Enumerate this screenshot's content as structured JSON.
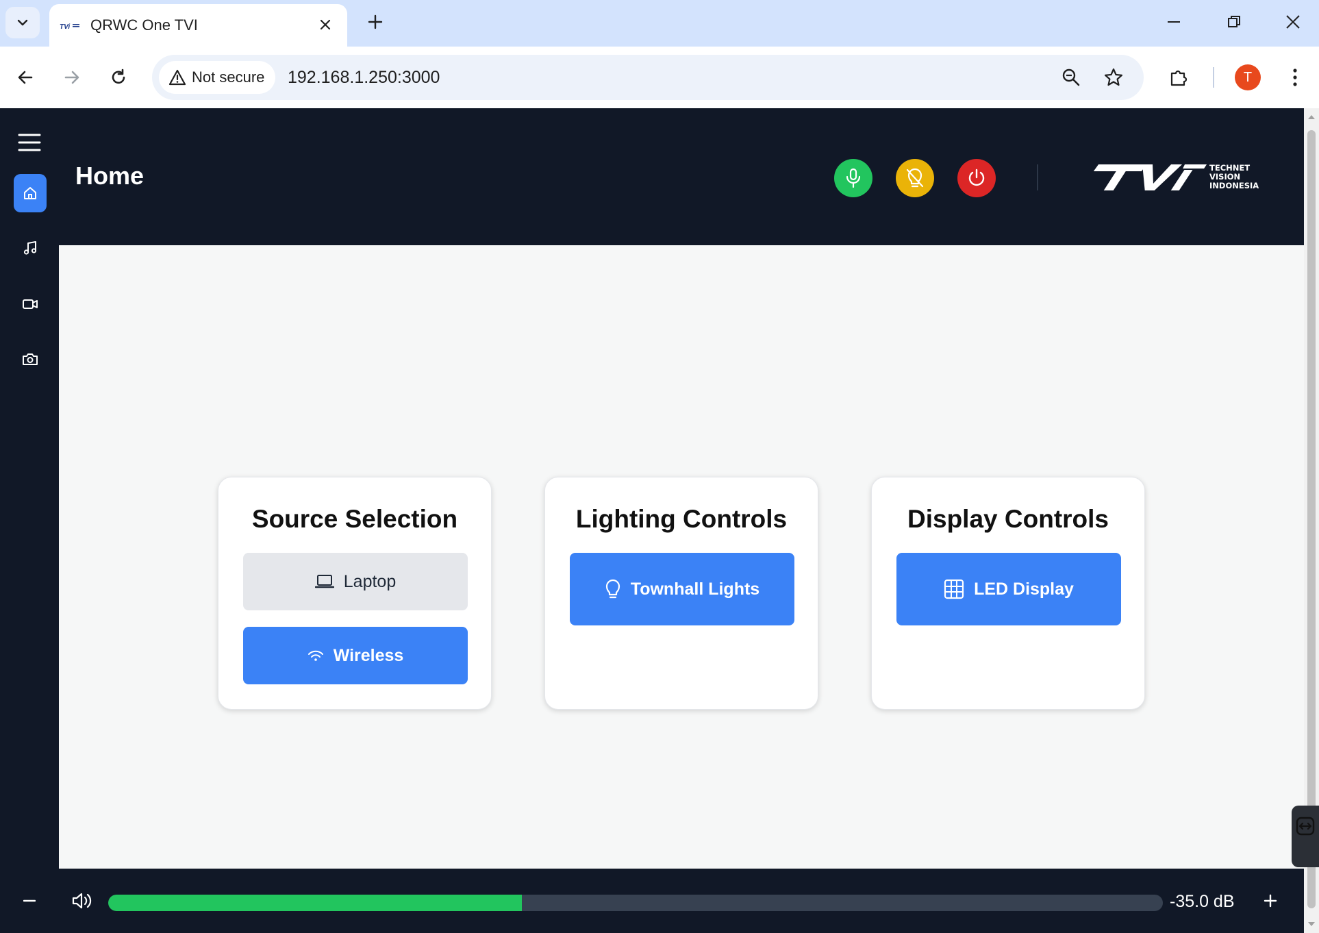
{
  "browser": {
    "tab_title": "QRWC One TVI",
    "security_label": "Not secure",
    "url": "192.168.1.250:3000",
    "profile_initial": "T"
  },
  "app": {
    "page_title": "Home",
    "sidebar": [
      {
        "icon": "home-icon",
        "active": true
      },
      {
        "icon": "music-icon",
        "active": false
      },
      {
        "icon": "video-icon",
        "active": false
      },
      {
        "icon": "camera-icon",
        "active": false
      }
    ],
    "header_buttons": [
      {
        "icon": "mic-icon",
        "color": "#22c55e"
      },
      {
        "icon": "light-off-icon",
        "color": "#eab308"
      },
      {
        "icon": "power-icon",
        "color": "#dc2626"
      }
    ],
    "logo": {
      "mark": "TVi",
      "line1": "TECHNET",
      "line2": "VISION",
      "line3": "INDONESIA"
    }
  },
  "cards": {
    "source": {
      "title": "Source Selection",
      "laptop_label": "Laptop",
      "wireless_label": "Wireless"
    },
    "lighting": {
      "title": "Lighting Controls",
      "townhall_label": "Townhall Lights"
    },
    "display": {
      "title": "Display Controls",
      "led_label": "LED Display"
    }
  },
  "volume": {
    "level_fraction": 0.392,
    "level_text": "-35.0 dB",
    "minus_label": "−",
    "plus_label": "+"
  },
  "colors": {
    "accent_blue": "#3b82f6",
    "volume_green": "#22c55e",
    "dark_bg": "#111827"
  }
}
